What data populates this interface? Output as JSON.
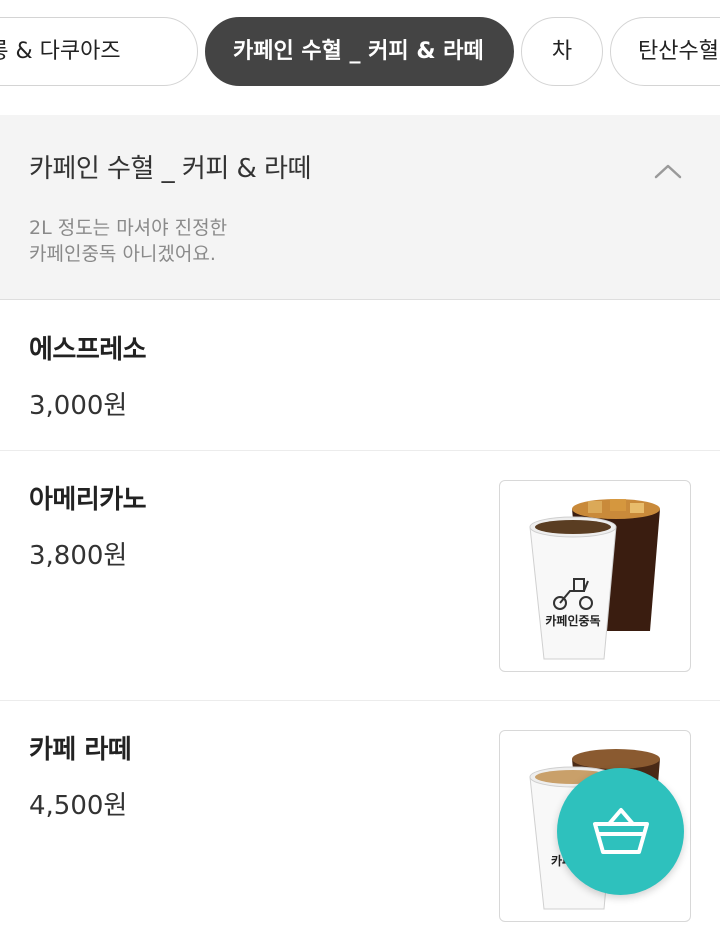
{
  "category_tabs": [
    {
      "label": "카롱 & 다쿠아즈",
      "active": false
    },
    {
      "label": "카페인 수혈 _ 커피 & 라떼",
      "active": true
    },
    {
      "label": "차",
      "active": false
    },
    {
      "label": "탄산수혈",
      "active": false
    }
  ],
  "section": {
    "title": "카페인 수혈 _ 커피 & 라떼",
    "description": "2L 정도는 마셔야 진정한\n카페인중독 아니겠어요.",
    "toggle_icon": "chevron-up-icon"
  },
  "menu_items": [
    {
      "name": "에스프레소",
      "price": "3,000원",
      "has_image": false
    },
    {
      "name": "아메리카노",
      "price": "3,800원",
      "has_image": true,
      "image_text": "카페인중독"
    },
    {
      "name": "카페 라떼",
      "price": "4,500원",
      "has_image": true,
      "image_text": "카페"
    }
  ],
  "cart_button": {
    "icon": "shopping-basket-icon"
  },
  "colors": {
    "active_tab": "#444444",
    "section_bg": "#f4f4f4",
    "cart_button": "#2ec1bd"
  }
}
